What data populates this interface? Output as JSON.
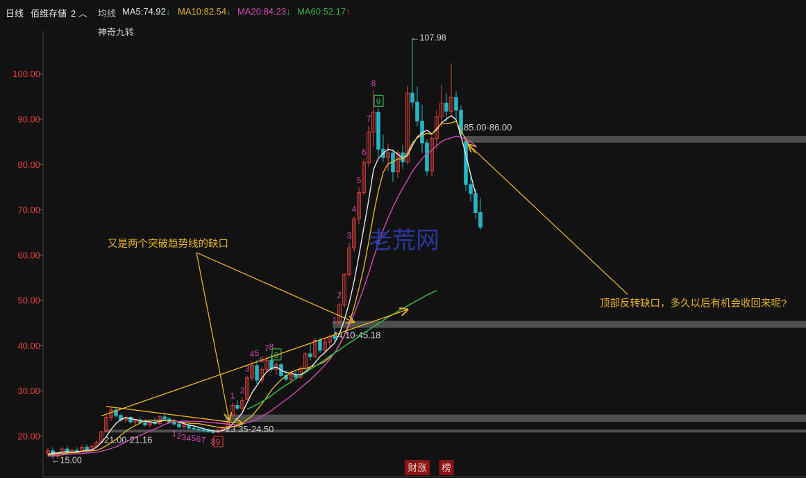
{
  "header": {
    "period": "日线",
    "stock_name": "佰维存储",
    "number": "2",
    "ma_label": "均线",
    "ma5": "MA5:74.92",
    "ma10": "MA10:82.54",
    "ma20": "MA20:84.23",
    "ma60": "MA60:52.17",
    "indicator": "神奇九转"
  },
  "chart_data": {
    "type": "candlestick",
    "y_axis": {
      "range": [
        16,
        109
      ],
      "ticks": [
        20,
        30,
        40,
        50,
        60,
        70,
        80,
        90,
        100
      ],
      "tick_labels": [
        "20.00",
        "30.00",
        "40.00",
        "50.00",
        "60.00",
        "70.00",
        "80.00",
        "90.00",
        "100.00"
      ]
    },
    "grid": false,
    "colors": {
      "up": "#e8413a",
      "down": "#26b5c4",
      "ma5": "#e8e8e8",
      "ma10": "#e6b422",
      "ma20": "#d44ab6",
      "ma60": "#35b04c",
      "annotation": "#e6b422",
      "nine_turn": "#d44ab6",
      "nine_turn_box": "#35b04c",
      "gap_band": "#5a5a5a"
    },
    "candles": [
      {
        "o": 16.2,
        "h": 17.4,
        "l": 15.4,
        "c": 16.8
      },
      {
        "o": 16.8,
        "h": 17.6,
        "l": 15.0,
        "c": 15.6
      },
      {
        "o": 15.6,
        "h": 16.6,
        "l": 15.1,
        "c": 16.2
      },
      {
        "o": 16.2,
        "h": 17.8,
        "l": 16.0,
        "c": 17.2
      },
      {
        "o": 17.2,
        "h": 17.8,
        "l": 16.0,
        "c": 16.4
      },
      {
        "o": 16.4,
        "h": 17.2,
        "l": 16.0,
        "c": 16.9
      },
      {
        "o": 16.9,
        "h": 17.6,
        "l": 16.4,
        "c": 16.7
      },
      {
        "o": 16.7,
        "h": 18.0,
        "l": 16.5,
        "c": 17.6
      },
      {
        "o": 17.6,
        "h": 18.2,
        "l": 16.9,
        "c": 17.1
      },
      {
        "o": 17.1,
        "h": 18.0,
        "l": 17.0,
        "c": 17.8
      },
      {
        "o": 17.8,
        "h": 19.0,
        "l": 17.6,
        "c": 18.6
      },
      {
        "o": 18.6,
        "h": 21.2,
        "l": 18.4,
        "c": 21.0
      },
      {
        "o": 21.16,
        "h": 24.8,
        "l": 21.1,
        "c": 24.2
      },
      {
        "o": 24.2,
        "h": 26.6,
        "l": 23.4,
        "c": 25.8
      },
      {
        "o": 25.8,
        "h": 26.2,
        "l": 24.2,
        "c": 24.6
      },
      {
        "o": 24.6,
        "h": 25.0,
        "l": 23.2,
        "c": 23.6
      },
      {
        "o": 23.6,
        "h": 24.6,
        "l": 23.0,
        "c": 24.2
      },
      {
        "o": 24.2,
        "h": 24.4,
        "l": 22.8,
        "c": 23.2
      },
      {
        "o": 23.2,
        "h": 23.8,
        "l": 22.4,
        "c": 23.5
      },
      {
        "o": 23.5,
        "h": 24.2,
        "l": 22.8,
        "c": 23.0
      },
      {
        "o": 23.0,
        "h": 23.8,
        "l": 22.2,
        "c": 22.5
      },
      {
        "o": 22.5,
        "h": 23.4,
        "l": 22.0,
        "c": 23.1
      },
      {
        "o": 23.1,
        "h": 24.0,
        "l": 22.6,
        "c": 22.8
      },
      {
        "o": 22.8,
        "h": 24.6,
        "l": 22.5,
        "c": 24.3
      },
      {
        "o": 24.3,
        "h": 25.2,
        "l": 23.4,
        "c": 23.8
      },
      {
        "o": 23.8,
        "h": 24.2,
        "l": 22.8,
        "c": 23.0
      },
      {
        "o": 23.0,
        "h": 23.8,
        "l": 22.4,
        "c": 22.7
      },
      {
        "o": 22.7,
        "h": 23.0,
        "l": 21.8,
        "c": 22.1
      },
      {
        "o": 22.1,
        "h": 22.8,
        "l": 21.6,
        "c": 22.5
      },
      {
        "o": 22.5,
        "h": 22.8,
        "l": 21.4,
        "c": 21.8
      },
      {
        "o": 21.8,
        "h": 22.4,
        "l": 21.4,
        "c": 21.6
      },
      {
        "o": 21.6,
        "h": 22.2,
        "l": 21.2,
        "c": 21.4
      },
      {
        "o": 21.4,
        "h": 22.0,
        "l": 21.0,
        "c": 21.3
      },
      {
        "o": 21.3,
        "h": 21.8,
        "l": 20.8,
        "c": 21.0
      },
      {
        "o": 21.0,
        "h": 21.6,
        "l": 20.6,
        "c": 20.9
      },
      {
        "o": 20.9,
        "h": 21.8,
        "l": 20.6,
        "c": 21.4
      },
      {
        "o": 21.4,
        "h": 22.2,
        "l": 21.0,
        "c": 21.8
      },
      {
        "o": 21.8,
        "h": 23.35,
        "l": 21.6,
        "c": 23.0
      },
      {
        "o": 24.5,
        "h": 27.4,
        "l": 24.3,
        "c": 26.8
      },
      {
        "o": 26.8,
        "h": 28.0,
        "l": 25.8,
        "c": 26.2
      },
      {
        "o": 26.2,
        "h": 28.6,
        "l": 25.6,
        "c": 27.9
      },
      {
        "o": 28.2,
        "h": 33.4,
        "l": 28.0,
        "c": 32.9
      },
      {
        "o": 32.9,
        "h": 36.6,
        "l": 32.2,
        "c": 35.6
      },
      {
        "o": 35.6,
        "h": 36.8,
        "l": 31.6,
        "c": 32.4
      },
      {
        "o": 32.4,
        "h": 35.4,
        "l": 31.8,
        "c": 34.8
      },
      {
        "o": 34.8,
        "h": 37.8,
        "l": 34.0,
        "c": 36.8
      },
      {
        "o": 36.8,
        "h": 38.2,
        "l": 34.2,
        "c": 34.8
      },
      {
        "o": 34.8,
        "h": 36.4,
        "l": 33.6,
        "c": 35.8
      },
      {
        "o": 35.8,
        "h": 36.2,
        "l": 33.0,
        "c": 33.4
      },
      {
        "o": 33.4,
        "h": 34.6,
        "l": 32.2,
        "c": 32.6
      },
      {
        "o": 32.6,
        "h": 34.4,
        "l": 31.6,
        "c": 33.6
      },
      {
        "o": 33.6,
        "h": 34.6,
        "l": 32.6,
        "c": 33.0
      },
      {
        "o": 33.0,
        "h": 35.4,
        "l": 32.6,
        "c": 35.0
      },
      {
        "o": 35.0,
        "h": 38.6,
        "l": 34.4,
        "c": 38.2
      },
      {
        "o": 38.2,
        "h": 40.4,
        "l": 36.8,
        "c": 37.6
      },
      {
        "o": 37.6,
        "h": 41.8,
        "l": 37.2,
        "c": 41.2
      },
      {
        "o": 41.2,
        "h": 41.8,
        "l": 38.4,
        "c": 39.0
      },
      {
        "o": 39.0,
        "h": 41.6,
        "l": 38.6,
        "c": 40.8
      },
      {
        "o": 40.8,
        "h": 42.6,
        "l": 39.6,
        "c": 42.0
      },
      {
        "o": 42.0,
        "h": 44.1,
        "l": 40.8,
        "c": 41.6
      },
      {
        "o": 45.18,
        "h": 49.6,
        "l": 44.6,
        "c": 49.0
      },
      {
        "o": 49.0,
        "h": 56.0,
        "l": 48.4,
        "c": 55.8
      },
      {
        "o": 55.8,
        "h": 62.8,
        "l": 55.2,
        "c": 61.6
      },
      {
        "o": 61.6,
        "h": 68.6,
        "l": 60.8,
        "c": 68.0
      },
      {
        "o": 68.0,
        "h": 75.0,
        "l": 66.8,
        "c": 73.8
      },
      {
        "o": 73.8,
        "h": 81.2,
        "l": 73.2,
        "c": 80.4
      },
      {
        "o": 80.4,
        "h": 88.6,
        "l": 79.6,
        "c": 87.2
      },
      {
        "o": 87.2,
        "h": 96.4,
        "l": 84.0,
        "c": 91.6
      },
      {
        "o": 91.6,
        "h": 92.4,
        "l": 81.8,
        "c": 83.4
      },
      {
        "o": 83.4,
        "h": 86.6,
        "l": 80.6,
        "c": 81.6
      },
      {
        "o": 81.6,
        "h": 84.6,
        "l": 78.6,
        "c": 82.6
      },
      {
        "o": 82.6,
        "h": 83.4,
        "l": 76.2,
        "c": 78.4
      },
      {
        "o": 78.4,
        "h": 83.2,
        "l": 77.0,
        "c": 82.6
      },
      {
        "o": 82.6,
        "h": 84.4,
        "l": 79.0,
        "c": 80.6
      },
      {
        "o": 80.6,
        "h": 97.4,
        "l": 80.0,
        "c": 95.8
      },
      {
        "o": 95.8,
        "h": 107.98,
        "l": 92.4,
        "c": 93.8
      },
      {
        "o": 93.8,
        "h": 97.2,
        "l": 88.4,
        "c": 89.6
      },
      {
        "o": 89.6,
        "h": 93.2,
        "l": 82.6,
        "c": 84.8
      },
      {
        "o": 84.8,
        "h": 85.6,
        "l": 77.6,
        "c": 78.6
      },
      {
        "o": 78.6,
        "h": 86.6,
        "l": 77.4,
        "c": 85.8
      },
      {
        "o": 85.8,
        "h": 92.0,
        "l": 83.4,
        "c": 90.6
      },
      {
        "o": 90.6,
        "h": 97.6,
        "l": 88.4,
        "c": 93.6
      },
      {
        "o": 93.6,
        "h": 95.8,
        "l": 89.4,
        "c": 91.8
      },
      {
        "o": 91.8,
        "h": 102.4,
        "l": 90.6,
        "c": 94.8
      },
      {
        "o": 94.8,
        "h": 96.2,
        "l": 89.2,
        "c": 92.0
      },
      {
        "o": 92.0,
        "h": 93.0,
        "l": 85.8,
        "c": 86.8
      },
      {
        "o": 85.0,
        "h": 86.0,
        "l": 74.2,
        "c": 75.6
      },
      {
        "o": 75.6,
        "h": 77.8,
        "l": 71.8,
        "c": 73.6
      },
      {
        "o": 73.6,
        "h": 74.6,
        "l": 68.0,
        "c": 69.4
      },
      {
        "o": 69.4,
        "h": 72.6,
        "l": 65.6,
        "c": 66.2
      }
    ],
    "ma_series": [
      {
        "name": "MA5",
        "values": [
          16.0,
          16.3,
          16.3,
          16.5,
          16.6,
          16.5,
          16.6,
          16.7,
          16.9,
          17.0,
          17.6,
          18.6,
          19.9,
          21.5,
          22.8,
          23.7,
          24.1,
          23.9,
          23.7,
          23.5,
          23.3,
          23.2,
          23.1,
          23.3,
          23.5,
          23.5,
          23.4,
          23.1,
          22.8,
          22.5,
          22.3,
          22.0,
          21.7,
          21.4,
          21.2,
          21.1,
          21.3,
          21.7,
          22.7,
          23.9,
          25.2,
          27.4,
          29.6,
          31.2,
          32.8,
          34.2,
          35.0,
          35.3,
          34.6,
          34.1,
          34.0,
          33.6,
          33.6,
          34.3,
          35.2,
          36.3,
          37.6,
          38.5,
          39.6,
          40.6,
          42.7,
          45.7,
          49.4,
          54.2,
          59.9,
          66.0,
          72.1,
          78.9,
          81.4,
          82.5,
          83.4,
          83.1,
          82.3,
          81.4,
          82.0,
          84.2,
          86.1,
          87.0,
          87.6,
          86.8,
          87.7,
          89.2,
          90.1,
          90.8,
          89.9,
          86.3,
          82.2,
          77.8,
          73.6
        ]
      },
      {
        "name": "MA10",
        "values": [
          15.8,
          16.0,
          16.1,
          16.2,
          16.3,
          16.4,
          16.4,
          16.6,
          16.7,
          16.8,
          16.9,
          17.3,
          17.9,
          18.6,
          19.3,
          20.2,
          21.1,
          21.8,
          22.4,
          22.9,
          23.5,
          23.6,
          23.5,
          23.6,
          23.5,
          23.5,
          23.4,
          23.2,
          23.1,
          22.9,
          22.8,
          22.8,
          22.6,
          22.4,
          22.2,
          22.0,
          21.9,
          21.9,
          22.1,
          22.4,
          22.9,
          23.7,
          24.5,
          25.8,
          27.1,
          28.6,
          30.2,
          31.4,
          32.5,
          33.3,
          34.1,
          34.6,
          34.9,
          35.0,
          35.3,
          35.6,
          36.0,
          36.5,
          37.4,
          38.4,
          40.3,
          42.3,
          44.9,
          48.5,
          52.6,
          57.2,
          62.8,
          69.0,
          74.2,
          78.3,
          80.2,
          80.6,
          81.3,
          81.2,
          82.6,
          84.8,
          85.9,
          86.5,
          86.9,
          86.7,
          88.0,
          89.1,
          89.1,
          89.2,
          89.6,
          87.5,
          85.5,
          83.8,
          82.6
        ]
      },
      {
        "name": "MA20",
        "values": [
          15.6,
          15.7,
          15.8,
          15.9,
          16.0,
          16.1,
          16.1,
          16.2,
          16.3,
          16.4,
          16.5,
          16.7,
          17.0,
          17.3,
          17.7,
          18.2,
          18.7,
          19.3,
          19.8,
          20.2,
          20.7,
          21.2,
          21.6,
          22.1,
          22.6,
          23.0,
          23.2,
          23.3,
          23.4,
          23.3,
          23.3,
          23.3,
          23.2,
          23.1,
          23.0,
          22.9,
          22.8,
          22.7,
          22.6,
          22.6,
          22.7,
          23.0,
          23.3,
          23.8,
          24.4,
          25.0,
          25.7,
          26.5,
          27.3,
          28.1,
          28.9,
          29.8,
          30.7,
          31.6,
          32.5,
          33.5,
          34.6,
          35.7,
          37.0,
          38.4,
          40.2,
          42.2,
          44.4,
          47.0,
          49.8,
          52.8,
          56.0,
          59.4,
          62.6,
          65.6,
          68.2,
          70.6,
          72.8,
          74.8,
          76.6,
          78.5,
          80.0,
          81.3,
          82.4,
          83.2,
          84.2,
          85.1,
          85.6,
          85.9,
          86.3,
          86.1,
          85.6,
          85.0,
          84.2
        ]
      },
      {
        "name": "MA60",
        "start_index": 41,
        "values": [
          26.0,
          26.5,
          27.0,
          27.6,
          28.3,
          29.0,
          29.8,
          30.6,
          31.3,
          32.0,
          32.7,
          33.4,
          34.1,
          34.8,
          35.5,
          36.2,
          36.9,
          37.7,
          38.4,
          39.1,
          39.9,
          40.6,
          41.3,
          42.0,
          42.8,
          43.5,
          44.2,
          44.9,
          45.6,
          46.3,
          46.9,
          47.6,
          48.2,
          48.8,
          49.4,
          50.0,
          50.6,
          51.2,
          51.7,
          52.2
        ]
      }
    ],
    "price_labels": [
      {
        "text": "←15.00",
        "index": 1,
        "value": 15.0
      },
      {
        "text": "←107.98",
        "index": 75,
        "value": 107.98
      }
    ],
    "gap_bands": [
      {
        "low": 21.0,
        "high": 21.16,
        "label": "21.00-21.16",
        "label_index": 12
      },
      {
        "low": 23.35,
        "high": 24.5,
        "label": "23.35-24.50",
        "label_index": 37
      },
      {
        "low": 44.1,
        "high": 45.18,
        "label": "44.10-45.18",
        "label_index": 59
      },
      {
        "low": 85.0,
        "high": 86.0,
        "label": "85.00-86.00",
        "label_index": 86
      }
    ],
    "nine_turn_marks": [
      {
        "text": "1",
        "index": 26
      },
      {
        "text": "2",
        "index": 27
      },
      {
        "text": "3",
        "index": 28
      },
      {
        "text": "4",
        "index": 29
      },
      {
        "text": "5",
        "index": 30
      },
      {
        "text": "6",
        "index": 31
      },
      {
        "text": "7",
        "index": 32
      },
      {
        "text": "8",
        "index": 34
      },
      {
        "text": "9",
        "index": 35,
        "boxed": true
      },
      {
        "text": "1",
        "index": 38
      },
      {
        "text": "2",
        "index": 40
      },
      {
        "text": "3",
        "index": 41
      },
      {
        "text": "4",
        "index": 42
      },
      {
        "text": "5",
        "index": 43
      },
      {
        "text": "6",
        "index": 44
      },
      {
        "text": "7",
        "index": 45
      },
      {
        "text": "8",
        "index": 46
      },
      {
        "text": "9",
        "index": 47,
        "boxed": true
      },
      {
        "text": "1",
        "index": 59
      },
      {
        "text": "2",
        "index": 60
      },
      {
        "text": "3",
        "index": 62
      },
      {
        "text": "4",
        "index": 63
      },
      {
        "text": "5",
        "index": 64
      },
      {
        "text": "6",
        "index": 65
      },
      {
        "text": "7",
        "index": 66
      },
      {
        "text": "8",
        "index": 67
      },
      {
        "text": "9",
        "index": 68,
        "boxed": true
      }
    ],
    "annotations": [
      {
        "text": "又是两个突破趋势线的缺口",
        "target": "gaps"
      },
      {
        "text": "顶部反转缺口，多久以后有机会收回来呢?",
        "target": "top-gap"
      }
    ],
    "watermark": "老荒网",
    "event_tags": [
      {
        "text": "财涨",
        "index": 76
      },
      {
        "text": "榜",
        "index": 82
      }
    ]
  }
}
